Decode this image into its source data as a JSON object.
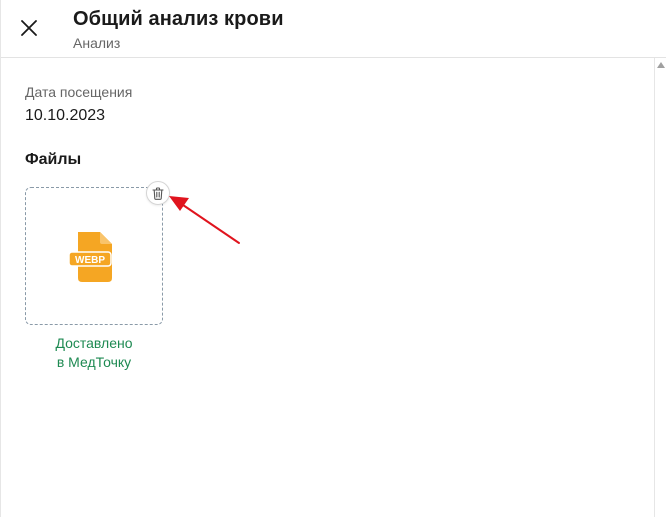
{
  "header": {
    "title": "Общий анализ крови",
    "subtitle": "Анализ"
  },
  "visit": {
    "label": "Дата посещения",
    "date": "10.10.2023"
  },
  "files": {
    "heading": "Файлы",
    "items": [
      {
        "type_label": "WEBP",
        "status_line1": "Доставлено",
        "status_line2": "в МедТочку"
      }
    ]
  },
  "colors": {
    "file_icon": "#f5a623",
    "status_text": "#1e8a52",
    "annotation_arrow": "#e0141e"
  },
  "icons": {
    "close": "close-icon",
    "delete": "trash-icon",
    "file": "webp-file-icon"
  }
}
